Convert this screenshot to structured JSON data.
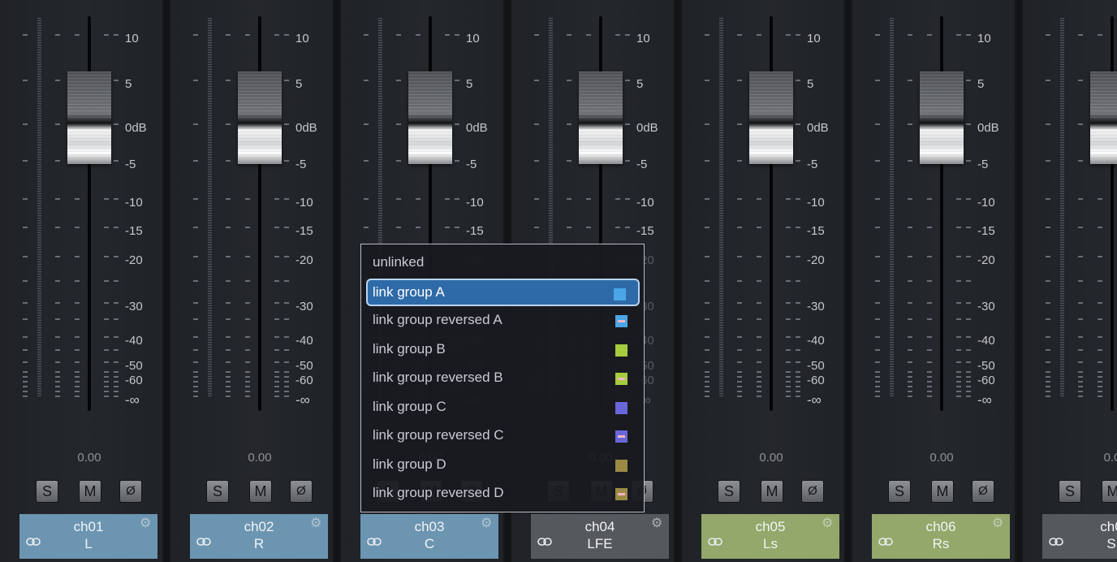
{
  "scale_labels": [
    "10",
    "5",
    "0dB",
    "-5",
    "-10",
    "-15",
    "-20",
    "-30",
    "-40",
    "-50",
    "-60",
    "-∞"
  ],
  "channels": [
    {
      "name": "ch01",
      "sub": "L",
      "value": "0.00",
      "color": "#6c95b1"
    },
    {
      "name": "ch02",
      "sub": "R",
      "value": "0.00",
      "color": "#6c95b1"
    },
    {
      "name": "ch03",
      "sub": "C",
      "value": "0.00",
      "color": "#6c95b1"
    },
    {
      "name": "ch04",
      "sub": "LFE",
      "value": "0.00",
      "color": "#55585d"
    },
    {
      "name": "ch05",
      "sub": "Ls",
      "value": "0.00",
      "color": "#93a86a"
    },
    {
      "name": "ch06",
      "sub": "Rs",
      "value": "0.00",
      "color": "#93a86a"
    },
    {
      "name": "ch0",
      "sub": "S",
      "value": "0.0",
      "color": "#55585d"
    }
  ],
  "buttons": {
    "solo": "S",
    "mute": "M",
    "phase": "Ø"
  },
  "link_menu": [
    {
      "label": "unlinked",
      "color": "",
      "reversed": false,
      "selected": false
    },
    {
      "label": "link group A",
      "color": "#4aa6e6",
      "reversed": false,
      "selected": true
    },
    {
      "label": "link group reversed A",
      "color": "#4aa6e6",
      "reversed": true,
      "selected": false
    },
    {
      "label": "link group B",
      "color": "#a6cc3e",
      "reversed": false,
      "selected": false
    },
    {
      "label": "link group reversed B",
      "color": "#a6cc3e",
      "reversed": true,
      "selected": false
    },
    {
      "label": "link group C",
      "color": "#6a66d8",
      "reversed": false,
      "selected": false
    },
    {
      "label": "link group reversed C",
      "color": "#6a66d8",
      "reversed": true,
      "selected": false
    },
    {
      "label": "link group D",
      "color": "#9a8a44",
      "reversed": false,
      "selected": false
    },
    {
      "label": "link group reversed D",
      "color": "#9a8a44",
      "reversed": true,
      "selected": false
    }
  ]
}
